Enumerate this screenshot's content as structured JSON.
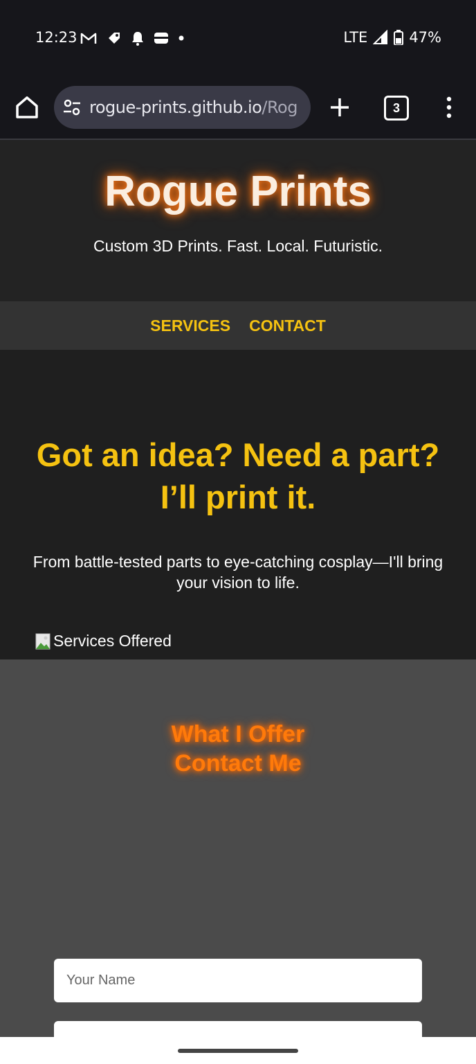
{
  "status_bar": {
    "time": "12:23",
    "icons": [
      "gmail-icon",
      "tag-icon",
      "bell-icon",
      "wallet-icon",
      "dot-icon"
    ],
    "network": "LTE",
    "battery": "47%"
  },
  "browser": {
    "url_main": "rogue-prints.github.io",
    "url_rest": "/Rog",
    "tab_count": "3"
  },
  "header": {
    "title": "Rogue Prints",
    "tagline": "Custom 3D Prints. Fast. Local. Futuristic."
  },
  "nav": {
    "items": [
      {
        "label": "SERVICES"
      },
      {
        "label": "CONTACT"
      }
    ]
  },
  "hero": {
    "headline_line1": "Got an idea? Need a part?",
    "headline_line2": "I’ll print it.",
    "subtext": "From battle-tested parts to eye-catching cosplay—I'll bring your vision to life."
  },
  "offer": {
    "title": "What I Offer",
    "image_alt": "Services Offered"
  },
  "contact": {
    "title": "Contact Me",
    "name_placeholder": "Your Name",
    "name_value": ""
  },
  "colors": {
    "accent_yellow": "#f5c211",
    "glow_orange": "#ff6a00",
    "header_bg": "#232323",
    "hero_bg": "#1f1f1f",
    "section_bg": "#4b4b4b"
  }
}
